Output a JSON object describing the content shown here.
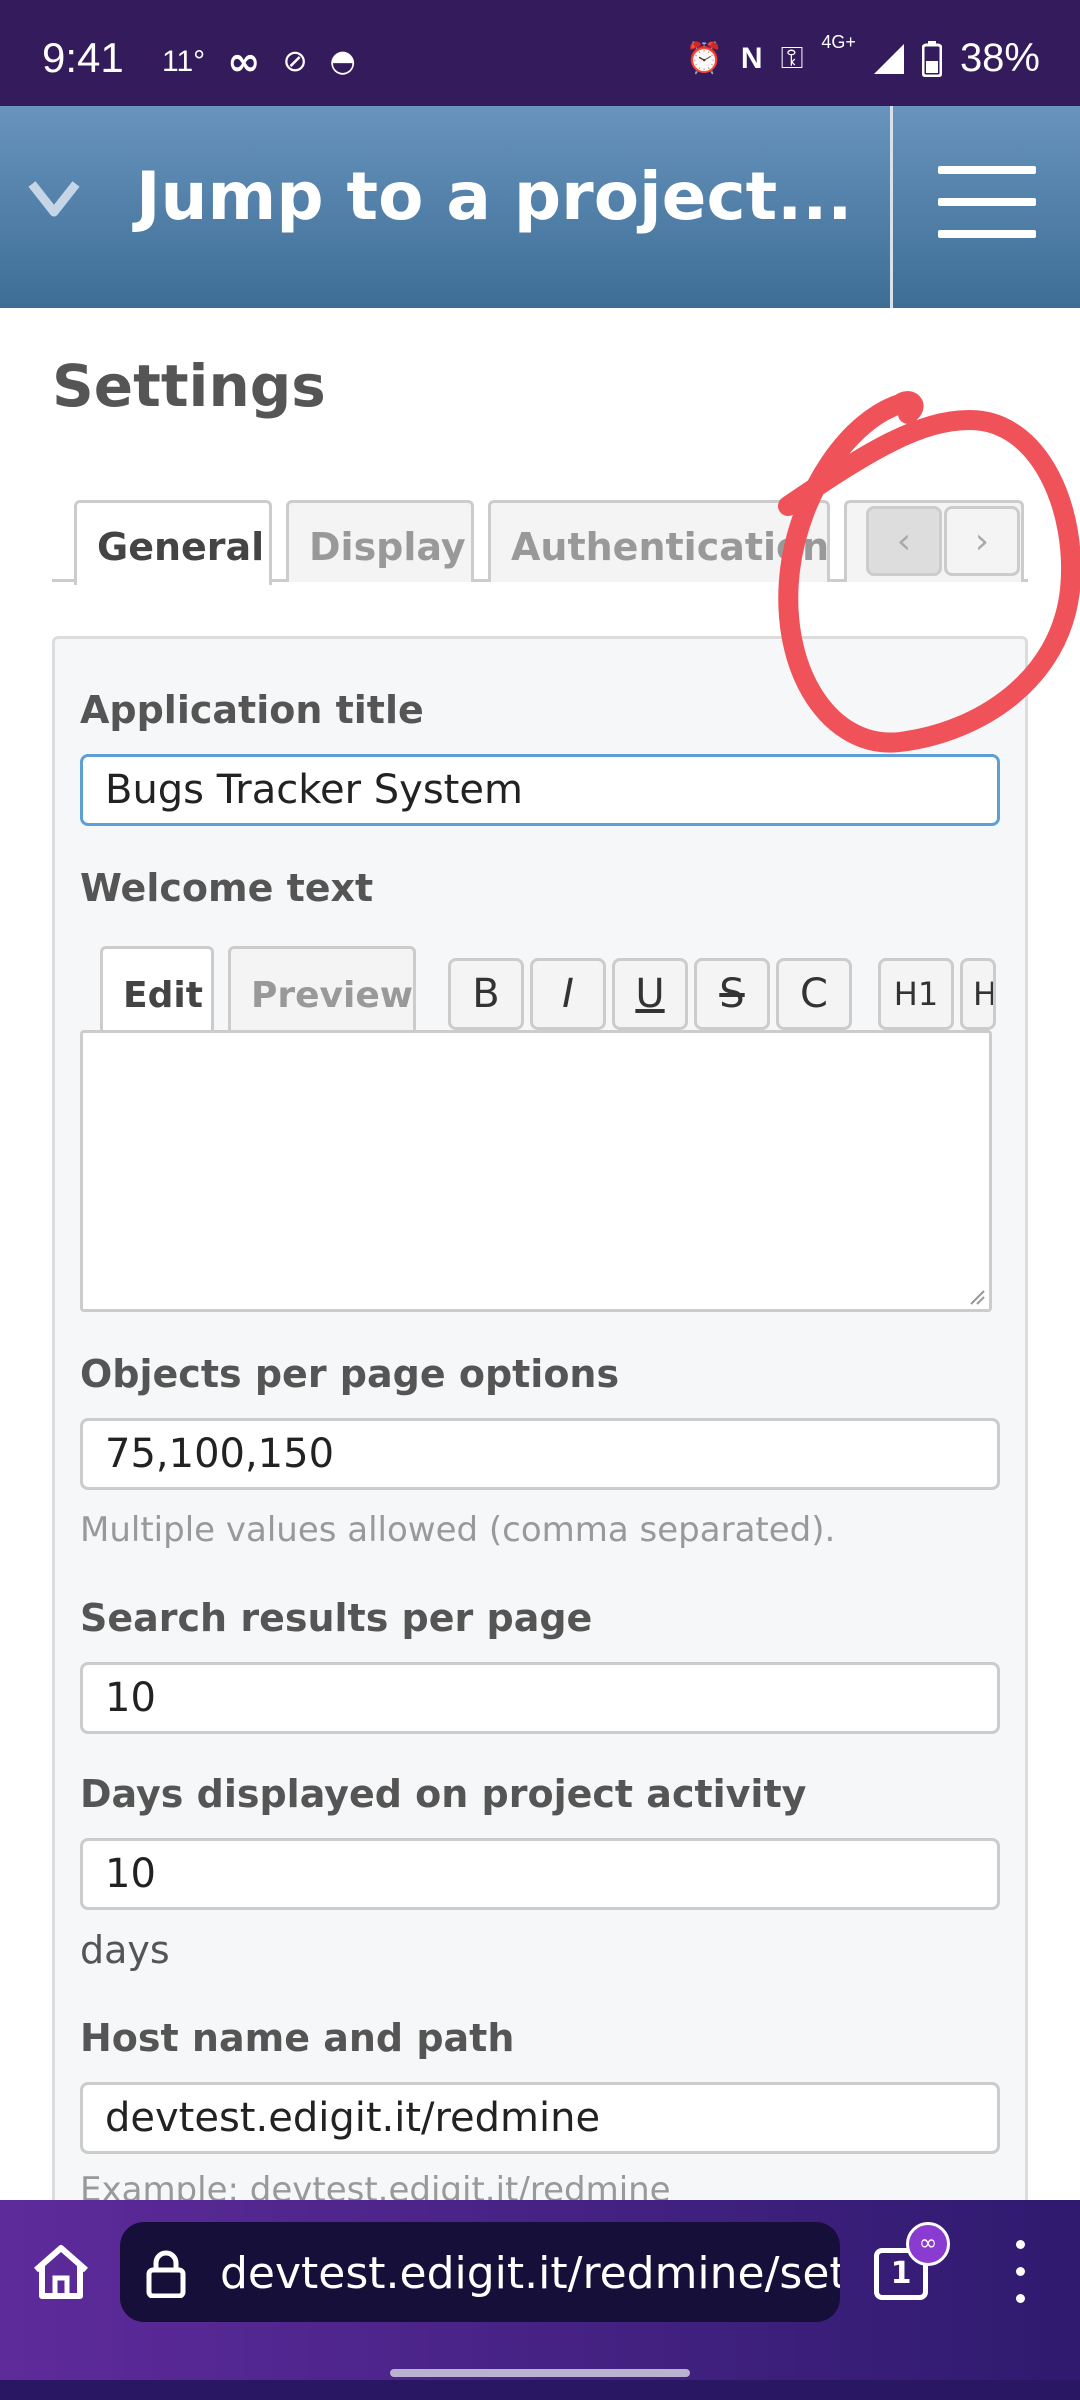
{
  "status_bar": {
    "time": "9:41",
    "temp": "11°",
    "battery": "38%",
    "network": "4G+"
  },
  "header": {
    "title": "Jump to a project..."
  },
  "page": {
    "title": "Settings"
  },
  "tabs": [
    {
      "label": "General"
    },
    {
      "label": "Display"
    },
    {
      "label": "Authentication"
    }
  ],
  "form": {
    "app_title_label": "Application title",
    "app_title_value": "Bugs Tracker System",
    "welcome_label": "Welcome text",
    "editor_tabs": [
      {
        "label": "Edit"
      },
      {
        "label": "Preview"
      }
    ],
    "toolbar": [
      "B",
      "I",
      "U",
      "S",
      "C",
      "H1",
      "H"
    ],
    "objects_label": "Objects per page options",
    "objects_value": "75,100,150",
    "objects_hint": "Multiple values allowed (comma separated).",
    "search_label": "Search results per page",
    "search_value": "10",
    "days_label": "Days displayed on project activity",
    "days_value": "10",
    "days_unit": "days",
    "host_label": "Host name and path",
    "host_value": "devtest.edigit.it/redmine",
    "host_hint": "Example: devtest.edigit.it/redmine"
  },
  "browser": {
    "url": "devtest.edigit.it/redmine/settings",
    "tab_count": "1"
  },
  "colors": {
    "status_bar": "#331b5c",
    "header_top": "#6894bd",
    "header_bottom": "#3d6d95",
    "annotation": "#f0525a"
  }
}
